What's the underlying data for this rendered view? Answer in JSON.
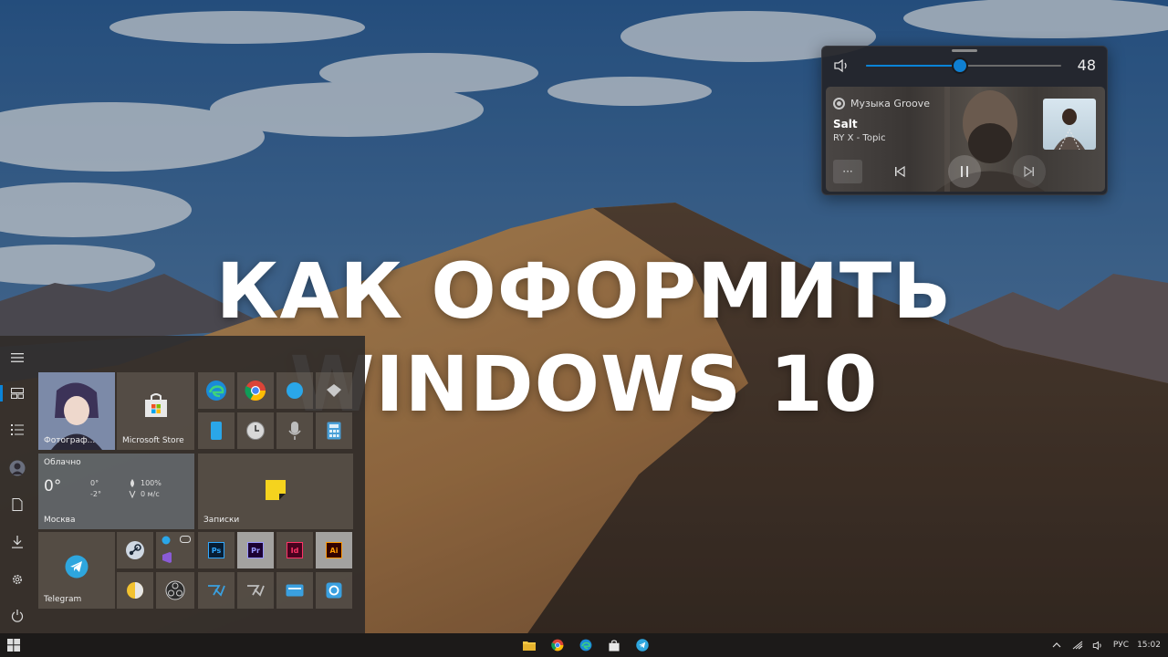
{
  "headline": {
    "line1": "КАК ОФОРМИТЬ",
    "line2": "WINDOWS 10"
  },
  "media_flyout": {
    "volume": 48,
    "volume_label": "48",
    "app_name": "Музыка Groove",
    "track_title": "Salt",
    "track_artist": "RY X - Topic",
    "more_label": "···",
    "icons": {
      "volume": "speaker-icon",
      "app": "groove-music-icon",
      "prev": "previous-track-icon",
      "play": "pause-icon",
      "next": "next-track-icon"
    }
  },
  "start_menu": {
    "rail_icons": [
      "hamburger-icon",
      "tiles-icon",
      "all-apps-icon",
      "user-avatar",
      "documents-icon",
      "downloads-icon",
      "settings-icon",
      "power-icon"
    ],
    "tiles": {
      "photos_label": "Фотограф...",
      "store_label": "Microsoft Store",
      "weather": {
        "condition": "Облачно",
        "temp": "0°",
        "high": "0°",
        "low": "-2°",
        "humidity": "100%",
        "wind": "0 м/с",
        "city": "Москва"
      },
      "notes_label": "Записки",
      "telegram_label": "Telegram",
      "ps_label": "Ps",
      "pr_label": "Pr",
      "id_label": "Id",
      "ai_label": "Ai"
    }
  },
  "taskbar": {
    "language": "РУС",
    "time": "15:02",
    "pinned": [
      "file-explorer-icon",
      "chrome-icon",
      "edge-icon",
      "store-icon",
      "telegram-icon"
    ]
  },
  "colors": {
    "accent": "#0a84d8",
    "sky": "#3f6a9a",
    "dune": "#b98a55"
  }
}
